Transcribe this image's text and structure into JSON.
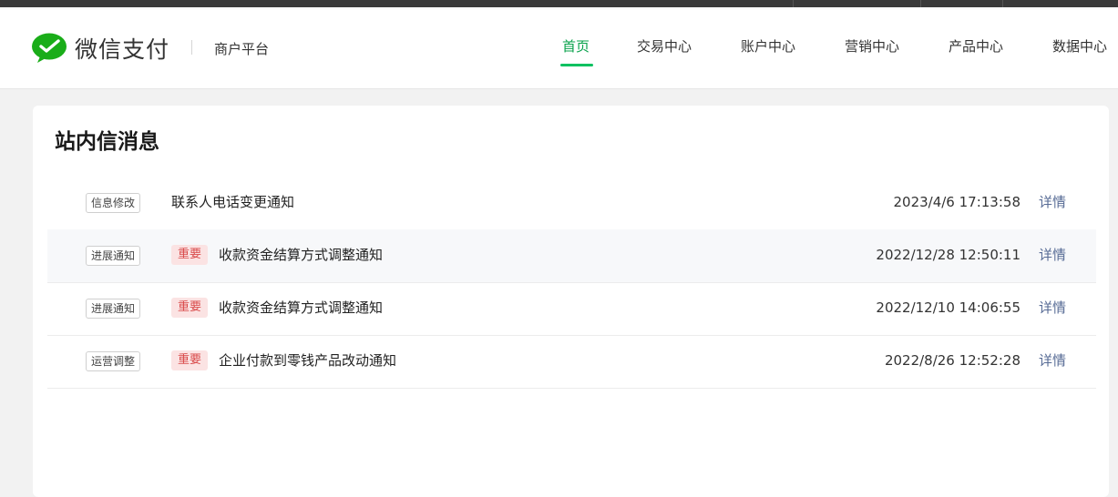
{
  "header": {
    "brand": "微信支付",
    "platform": "商户平台",
    "brand_color": "#07c160",
    "nav": [
      {
        "label": "首页",
        "active": true
      },
      {
        "label": "交易中心",
        "active": false
      },
      {
        "label": "账户中心",
        "active": false
      },
      {
        "label": "营销中心",
        "active": false
      },
      {
        "label": "产品中心",
        "active": false
      },
      {
        "label": "数据中心",
        "active": false
      }
    ]
  },
  "main": {
    "title": "站内信消息",
    "important_label": "重要",
    "detail_label": "详情",
    "messages": [
      {
        "tag": "信息修改",
        "important": false,
        "title": "联系人电话变更通知",
        "time": "2023/4/6 17:13:58"
      },
      {
        "tag": "进展通知",
        "important": true,
        "title": "收款资金结算方式调整通知",
        "time": "2022/12/28 12:50:11"
      },
      {
        "tag": "进展通知",
        "important": true,
        "title": "收款资金结算方式调整通知",
        "time": "2022/12/10 14:06:55"
      },
      {
        "tag": "运营调整",
        "important": true,
        "title": "企业付款到零钱产品改动通知",
        "time": "2022/8/26 12:52:28"
      }
    ]
  }
}
